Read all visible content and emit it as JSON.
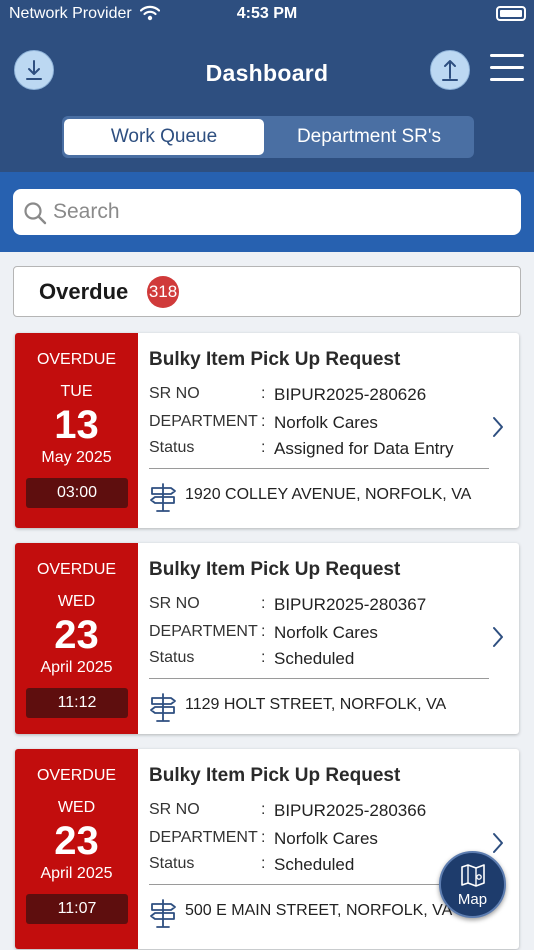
{
  "status_bar": {
    "carrier": "Network Provider",
    "time": "4:53 PM"
  },
  "header": {
    "title": "Dashboard"
  },
  "tabs": [
    {
      "label": "Work Queue",
      "active": true
    },
    {
      "label": "Department SR's",
      "active": false
    }
  ],
  "search": {
    "placeholder": "Search",
    "value": ""
  },
  "overdue": {
    "label": "Overdue",
    "count": "318"
  },
  "labels": {
    "sr_no": "SR NO",
    "department": "DEPARTMENT",
    "status": "Status",
    "separator": ":"
  },
  "cards": [
    {
      "flag": "OVERDUE",
      "weekday": "TUE",
      "day": "13",
      "month_year": "May 2025",
      "time": "03:00",
      "title": "Bulky Item Pick Up Request",
      "sr_no": "BIPUR2025-280626",
      "department": "Norfolk Cares",
      "status": "Assigned for Data Entry",
      "address": "1920 COLLEY AVENUE, NORFOLK, VA"
    },
    {
      "flag": "OVERDUE",
      "weekday": "WED",
      "day": "23",
      "month_year": "April 2025",
      "time": "11:12",
      "title": "Bulky Item Pick Up Request",
      "sr_no": "BIPUR2025-280367",
      "department": "Norfolk Cares",
      "status": "Scheduled",
      "address": "1129 HOLT STREET, NORFOLK, VA"
    },
    {
      "flag": "OVERDUE",
      "weekday": "WED",
      "day": "23",
      "month_year": "April 2025",
      "time": "11:07",
      "title": "Bulky Item Pick Up Request",
      "sr_no": "BIPUR2025-280366",
      "department": "Norfolk Cares",
      "status": "Scheduled",
      "address": "500 E MAIN STREET, NORFOLK, VA"
    }
  ],
  "map_button": {
    "label": "Map"
  },
  "icons": {
    "download": "download-icon",
    "upload": "upload-icon",
    "menu": "hamburger-menu-icon",
    "search": "search-icon",
    "address": "signpost-icon",
    "chevron": "chevron-right-icon",
    "map": "map-icon"
  },
  "colors": {
    "header": "#2e4f80",
    "search_band": "#2761b0",
    "overdue_red": "#c20d0d",
    "time_box": "#5e0e0e",
    "badge": "#d03a3a"
  }
}
